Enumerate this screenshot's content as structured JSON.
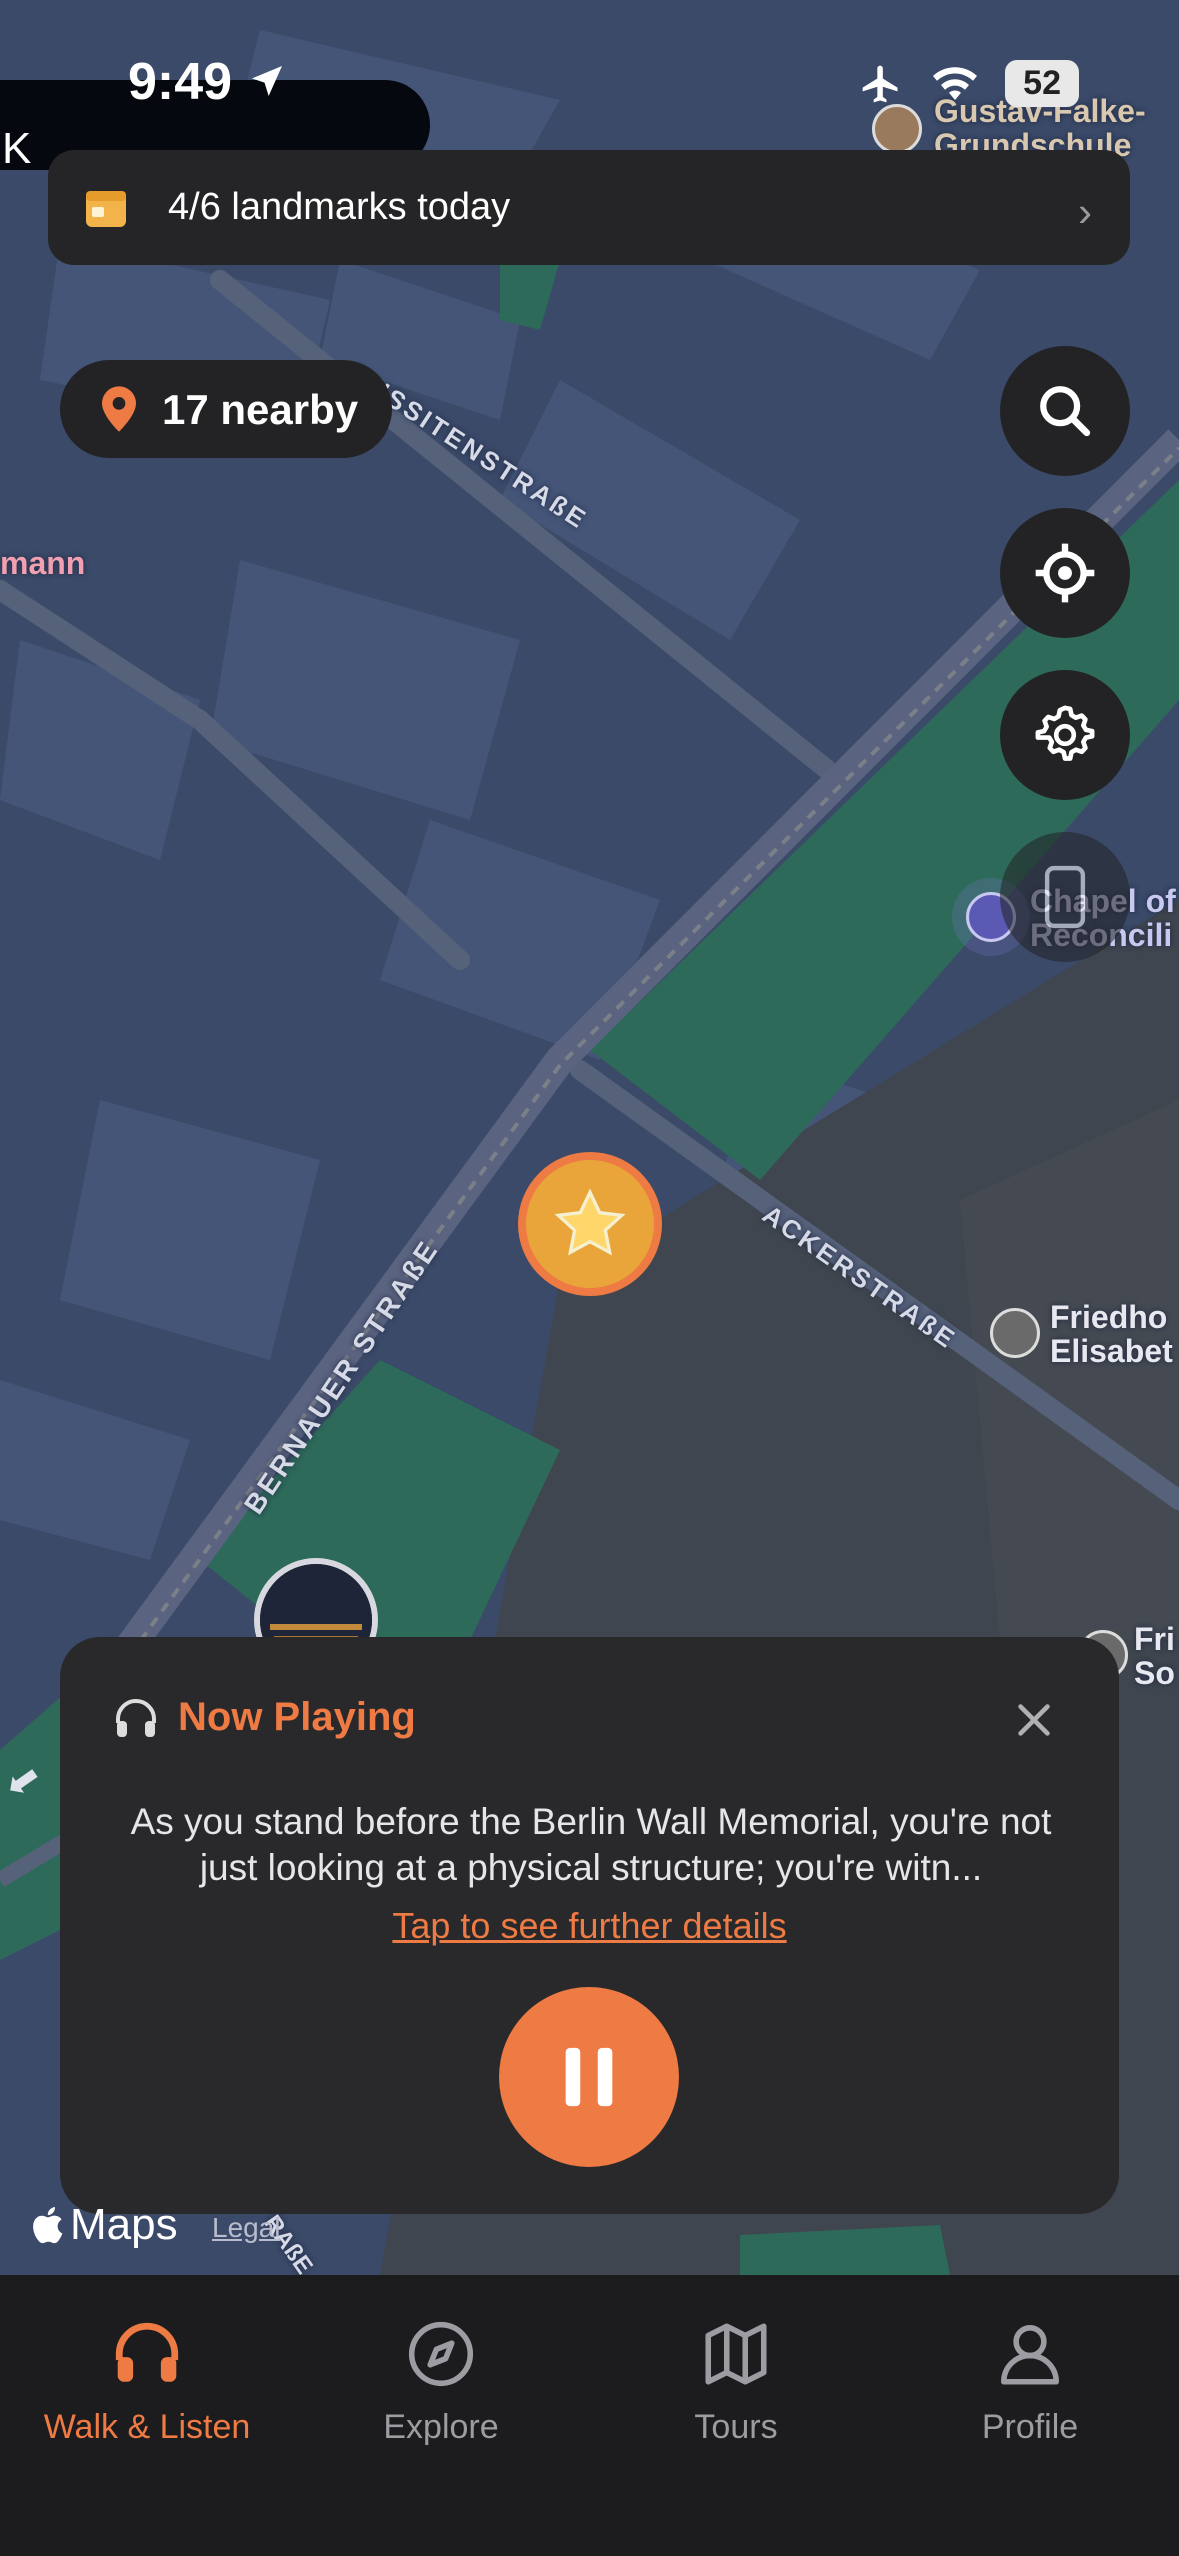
{
  "status_bar": {
    "time": "9:49",
    "battery": "52"
  },
  "overlay_fragment": "K",
  "banner": {
    "text": "4/6 landmarks today"
  },
  "nearby": {
    "text": "17 nearby"
  },
  "map": {
    "streets": [
      "HUSSITENSTRASSE",
      "ACKERSTRASSE",
      "BERNAUER STRASSE",
      "STRASSE"
    ],
    "streets_display": [
      "HUSSITENSTRAßE",
      "ACKERSTRAßE",
      "BERNAUER STRAßE",
      "RAßE"
    ],
    "pois": [
      {
        "name_line1": "Gustav-Falke-",
        "name_line2": "Grundschule"
      },
      {
        "name_line1": "Chapel of",
        "name_line2": "Reconcili"
      },
      {
        "name_line1": "Friedho",
        "name_line2": "Elisabet"
      },
      {
        "name_line1": "Fri",
        "name_line2": "So"
      },
      {
        "name_line1": "mann",
        "name_line2": ""
      }
    ]
  },
  "player": {
    "title": "Now Playing",
    "description": "As you stand before the Berlin Wall Memorial, you're not just looking at a physical structure; you're witn...",
    "link": "Tap to see further details"
  },
  "attribution": {
    "maps": "Maps",
    "legal": "Legal"
  },
  "tabs": [
    {
      "label": "Walk & Listen",
      "icon": "headphones-icon",
      "active": true
    },
    {
      "label": "Explore",
      "icon": "compass-icon",
      "active": false
    },
    {
      "label": "Tours",
      "icon": "map-icon",
      "active": false
    },
    {
      "label": "Profile",
      "icon": "person-icon",
      "active": false
    }
  ],
  "colors": {
    "accent": "#ee7a44",
    "card": "#29292b",
    "tabbar": "#1c1c1e",
    "map_base": "#3a4a68",
    "park": "#2e6a5a"
  }
}
